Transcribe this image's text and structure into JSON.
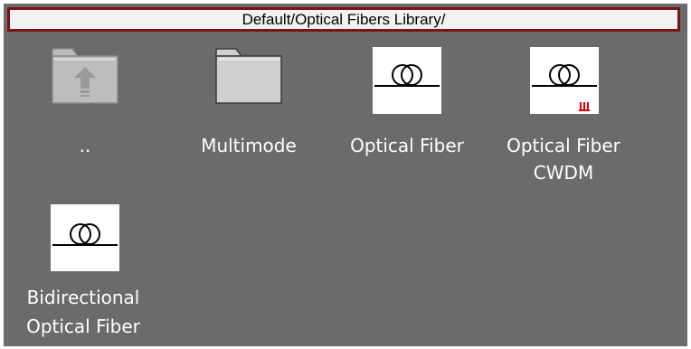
{
  "path_bar": {
    "text": "Default/Optical Fibers Library/"
  },
  "items": [
    {
      "label": "..",
      "icon": "folder-up-icon"
    },
    {
      "label": "Multimode",
      "icon": "folder-icon"
    },
    {
      "label": "Optical Fiber",
      "icon": "optical-fiber-icon"
    },
    {
      "label_line1": "Optical Fiber",
      "label_line2": "CWDM",
      "icon": "optical-fiber-cwdm-icon"
    },
    {
      "label_line1": "Bidirectional",
      "label_line2": "Optical Fiber",
      "icon": "bidirectional-optical-fiber-icon"
    }
  ],
  "colors": {
    "background": "#6b6b6b",
    "path_border": "#7a1515",
    "folder_fill": "#c8c8c8",
    "cwdm_marks": "#e00000"
  }
}
